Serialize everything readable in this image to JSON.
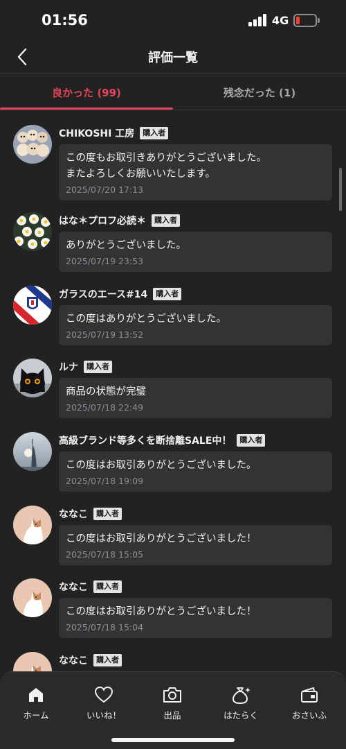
{
  "status_bar": {
    "time": "01:56",
    "network": "4G"
  },
  "header": {
    "title": "評価一覧"
  },
  "tabs": [
    {
      "label": "良かった (99)",
      "active": true
    },
    {
      "label": "残念だった (1)",
      "active": false
    }
  ],
  "colors": {
    "accent": "#e8435a",
    "background": "#222223",
    "bubble": "#333335",
    "badge": "#e4e4e4"
  },
  "reviews": [
    {
      "name": "CHIKOSHI 工房",
      "badge": "購入者",
      "message": "この度もお取引きありがとうございました。\nまたよろしくお願いいたします。",
      "date": "2025/07/20 17:13",
      "avatar": "puppies-avatar"
    },
    {
      "name": "はな＊プロフ必読＊",
      "badge": "購入者",
      "message": "ありがとうございました。",
      "date": "2025/07/19 23:53",
      "avatar": "daisies-avatar"
    },
    {
      "name": "ガラスのエース#14",
      "badge": "購入者",
      "message": "この度はありがとうございました。",
      "date": "2025/07/19 13:52",
      "avatar": "team-emblem-avatar"
    },
    {
      "name": "ルナ",
      "badge": "購入者",
      "message": "商品の状態が完璧",
      "date": "2025/07/18 22:49",
      "avatar": "black-cat-avatar"
    },
    {
      "name": "高級ブランド等多くを断捨離SALE中！",
      "badge": "購入者",
      "message": "この度はお取引ありがとうございました。",
      "date": "2025/07/18 19:09",
      "avatar": "tower-avatar"
    },
    {
      "name": "ななこ",
      "badge": "購入者",
      "message": "この度はお取引ありがとうございました！",
      "date": "2025/07/18 15:05",
      "avatar": "cat-illustration-avatar"
    },
    {
      "name": "ななこ",
      "badge": "購入者",
      "message": "この度はお取引ありがとうございました！",
      "date": "2025/07/18 15:04",
      "avatar": "cat-illustration-avatar"
    },
    {
      "name": "ななこ",
      "badge": "購入者",
      "message": "",
      "date": "",
      "avatar": "cat-illustration-avatar"
    }
  ],
  "bottom_nav": [
    {
      "label": "ホーム",
      "icon": "home-icon"
    },
    {
      "label": "いいね！",
      "icon": "heart-icon"
    },
    {
      "label": "出品",
      "icon": "camera-icon"
    },
    {
      "label": "はたらく",
      "icon": "money-bag-icon"
    },
    {
      "label": "おさいふ",
      "icon": "wallet-icon"
    }
  ]
}
